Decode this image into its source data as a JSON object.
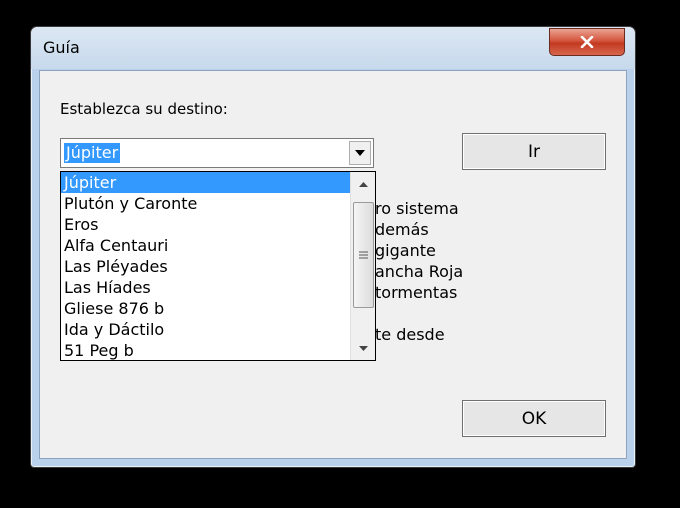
{
  "window": {
    "title": "Guía",
    "close_label": "x"
  },
  "form": {
    "destination_label": "Establezca su destino:",
    "combo_value": "Júpiter",
    "go_button": "Ir",
    "ok_button": "OK"
  },
  "dropdown_items": [
    "Júpiter",
    "Plutón y Caronte",
    "Eros",
    "Alfa Centauri",
    "Las Pléyades",
    "Las Híades",
    "Gliese 876 b",
    "Ida y Dáctilo",
    "51 Peg b"
  ],
  "selected_index": 0,
  "partially_hidden_text": [
    "ro sistema",
    "demás",
    "gigante",
    "ancha Roja",
    "tormentas",
    "te desde"
  ],
  "colors": {
    "selection": "#3399ff",
    "close_button": "#c23a22"
  }
}
